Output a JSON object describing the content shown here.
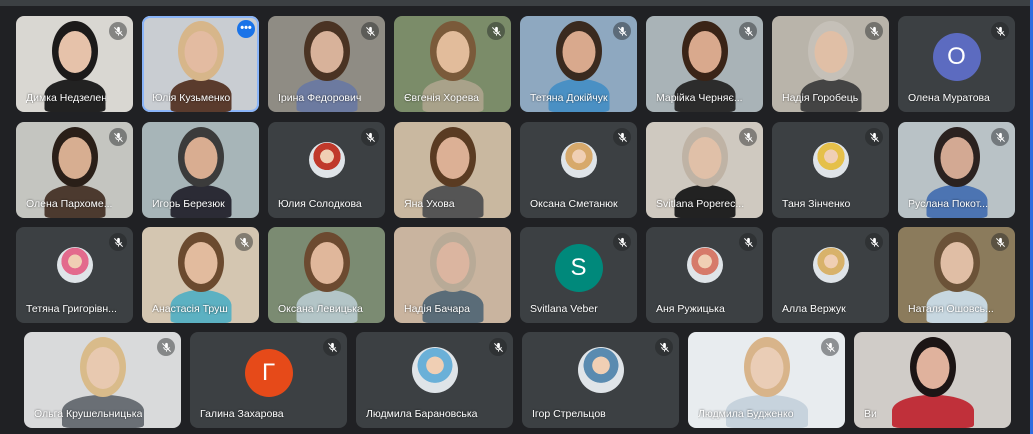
{
  "participants": [
    [
      {
        "name": "Димка Недзелен",
        "type": "video",
        "bg": "#d9d7d2",
        "hair": "#1c1a1a",
        "skin": "#e6c2aa",
        "shirt": "#222222",
        "muted": true
      },
      {
        "name": "Юлія Кузьменко",
        "type": "video",
        "bg": "#c9cdd2",
        "hair": "#d7b68a",
        "skin": "#e3bba1",
        "shirt": "#5a3b2d",
        "muted": false,
        "active": true,
        "more": "•••"
      },
      {
        "name": "Ірина Федорович",
        "type": "video",
        "bg": "#8f8c84",
        "hair": "#4a3323",
        "skin": "#d8b29a",
        "shirt": "#6c7aa0",
        "muted": true
      },
      {
        "name": "Євгенія Хорева",
        "type": "video",
        "bg": "#7b8c69",
        "hair": "#7a5a3a",
        "skin": "#e2bc9b",
        "shirt": "#a9a28a",
        "muted": true
      },
      {
        "name": "Тетяна Докійчук",
        "type": "video",
        "bg": "#8ea8c0",
        "hair": "#3a2a1f",
        "skin": "#d9a98d",
        "shirt": "#4a90c4",
        "muted": true
      },
      {
        "name": "Марійка Черняє...",
        "type": "video",
        "bg": "#a9b3b7",
        "hair": "#3a2417",
        "skin": "#d9a98d",
        "shirt": "#2c2c2c",
        "muted": true
      },
      {
        "name": "Надія Горобець",
        "type": "video",
        "bg": "#b9b4aa",
        "hair": "#c5c0b8",
        "skin": "#e0bfa6",
        "shirt": "#444444",
        "muted": true
      },
      {
        "name": "Олена Муратова",
        "type": "avatar",
        "letter": "О",
        "color": "#5c6bc0",
        "muted": true
      }
    ],
    [
      {
        "name": "Олена Пархоме...",
        "type": "video",
        "bg": "#c4c5c0",
        "hair": "#2a1f18",
        "skin": "#d7ae91",
        "shirt": "#4c3a2f",
        "muted": true
      },
      {
        "name": "Игорь Березюк",
        "type": "video",
        "bg": "#a7b5b8",
        "hair": "#3b3b3b",
        "skin": "#d9ad91",
        "shirt": "#2b2b35",
        "muted": false
      },
      {
        "name": "Юлия Солодкова",
        "type": "photo",
        "accent": "#c0392b",
        "muted": true
      },
      {
        "name": "Яна Ухова",
        "type": "video",
        "bg": "#c9b8a0",
        "hair": "#5a3b22",
        "skin": "#dcb095",
        "shirt": "#555555",
        "muted": false
      },
      {
        "name": "Оксана Сметанюк",
        "type": "photo",
        "accent": "#d7a96b",
        "muted": true
      },
      {
        "name": "Svitlana Poperec...",
        "type": "video",
        "bg": "#cfc9c0",
        "hair": "#bfb3a5",
        "skin": "#e0c0a8",
        "shirt": "#222222",
        "muted": true
      },
      {
        "name": "Таня Зінченко",
        "type": "photo",
        "accent": "#e5c04a",
        "muted": true
      },
      {
        "name": "Руслана Покот...",
        "type": "video",
        "bg": "#b9c2c6",
        "hair": "#2b2220",
        "skin": "#d3a993",
        "shirt": "#4c74b2",
        "muted": true
      }
    ],
    [
      {
        "name": "Тетяна Григорівн...",
        "type": "photo",
        "accent": "#e36a8d",
        "muted": true
      },
      {
        "name": "Анастасія Труш",
        "type": "video",
        "bg": "#d4c6b1",
        "hair": "#6b4a2f",
        "skin": "#e2bb9e",
        "shirt": "#5cb1c2",
        "muted": true
      },
      {
        "name": "Оксана Левицька",
        "type": "video",
        "bg": "#7b8b72",
        "hair": "#6c4a30",
        "skin": "#e0b79b",
        "shirt": "#b3c5c7",
        "muted": false
      },
      {
        "name": "Надія Бачара",
        "type": "video",
        "bg": "#c9b49f",
        "hair": "#b8aa97",
        "skin": "#dbb5a0",
        "shirt": "#5a6c78",
        "muted": false
      },
      {
        "name": "Svitlana Veber",
        "type": "avatar",
        "letter": "S",
        "color": "#00897b",
        "muted": true
      },
      {
        "name": "Аня Ружицька",
        "type": "photo",
        "accent": "#d67a6a",
        "muted": true
      },
      {
        "name": "Алла Вержук",
        "type": "photo",
        "accent": "#d8b26a",
        "muted": true
      },
      {
        "name": "Наталя Ошовсь...",
        "type": "video",
        "bg": "#8b7b5c",
        "hair": "#6b5238",
        "skin": "#e0bea5",
        "shirt": "#c7d7e0",
        "muted": true
      }
    ],
    [
      {
        "name": "Ольга Крушельницька",
        "type": "video",
        "bg": "#d9dadb",
        "hair": "#d9bb8a",
        "skin": "#e8c9b0",
        "shirt": "#6a6f75",
        "muted": true
      },
      {
        "name": "Галина Захарова",
        "type": "avatar",
        "letter": "Г",
        "color": "#e64a19",
        "muted": true
      },
      {
        "name": "Людмила Барановська",
        "type": "photo",
        "accent": "#6ab0d8",
        "muted": true
      },
      {
        "name": "Ігор Стрельцов",
        "type": "photo",
        "accent": "#5a8bb0",
        "muted": true
      },
      {
        "name": "Людмила Будженко",
        "type": "video",
        "bg": "#e8ecef",
        "hair": "#d8b48a",
        "skin": "#eacdb6",
        "shirt": "#c7d3dd",
        "muted": true
      },
      {
        "name": "Ви",
        "type": "video",
        "bg": "#d0ccc8",
        "hair": "#1c1515",
        "skin": "#e0b29d",
        "shirt": "#c0303a",
        "muted": false
      }
    ]
  ]
}
